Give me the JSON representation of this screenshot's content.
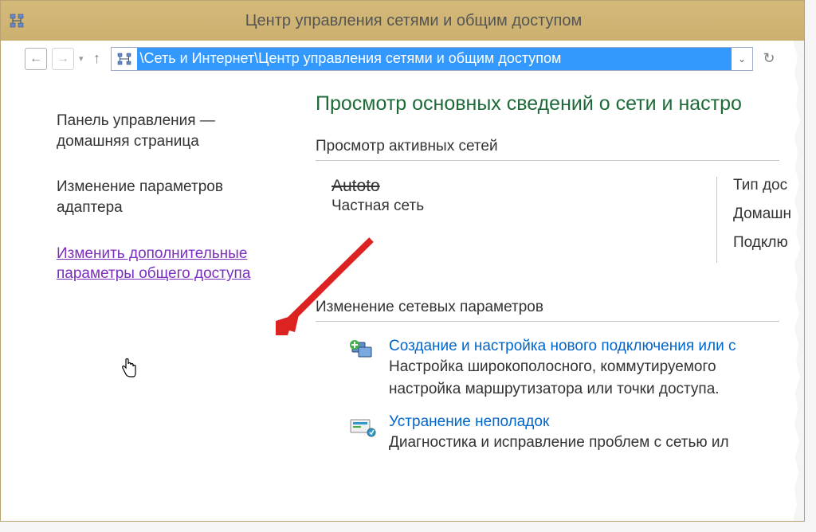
{
  "window": {
    "title": "Центр управления сетями и общим доступом"
  },
  "address": {
    "path": "\\Сеть и Интернет\\Центр управления сетями и общим доступом"
  },
  "sidebar": {
    "home": "Панель управления — домашняя страница",
    "adapter": "Изменение параметров адаптера",
    "advanced": "Изменить дополнительные параметры общего доступа"
  },
  "main": {
    "title": "Просмотр основных сведений о сети и настро",
    "active_networks_label": "Просмотр активных сетей",
    "network": {
      "name": "Autoto",
      "type": "Частная сеть"
    },
    "info": {
      "access_type": "Тип дос",
      "home_group": "Домашн",
      "connections": "Подклю"
    },
    "change_settings_label": "Изменение сетевых параметров",
    "setup": {
      "link": "Создание и настройка нового подключения или с",
      "desc1": "Настройка широкополосного, коммутируемого",
      "desc2": "настройка маршрутизатора или точки доступа."
    },
    "troubleshoot": {
      "link": "Устранение неполадок",
      "desc": "Диагностика и исправление проблем с сетью ил"
    }
  }
}
